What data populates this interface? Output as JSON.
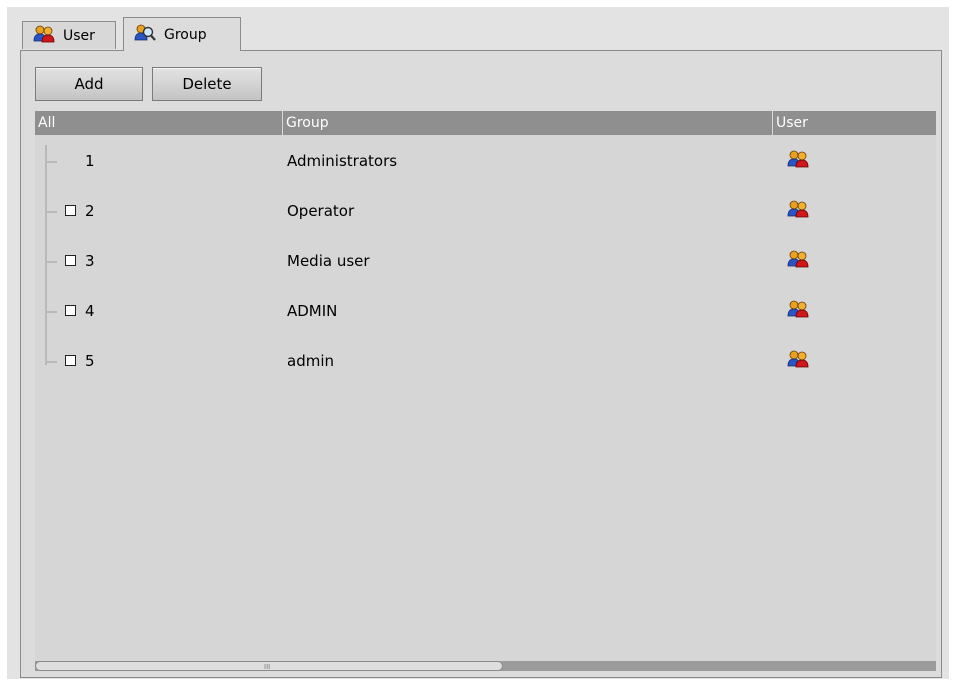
{
  "tabs": [
    {
      "label": "User",
      "icon": "users-icon",
      "active": false
    },
    {
      "label": "Group",
      "icon": "group-search-icon",
      "active": true
    }
  ],
  "toolbar": {
    "add_label": "Add",
    "delete_label": "Delete"
  },
  "table": {
    "headers": {
      "all": "All",
      "group": "Group",
      "user": "User"
    },
    "rows": [
      {
        "num": "1",
        "group": "Administrators",
        "checkbox": false
      },
      {
        "num": "2",
        "group": "Operator",
        "checkbox": true
      },
      {
        "num": "3",
        "group": "Media user",
        "checkbox": true
      },
      {
        "num": "4",
        "group": "ADMIN",
        "checkbox": true
      },
      {
        "num": "5",
        "group": "admin",
        "checkbox": true
      }
    ]
  },
  "scrollbar": {
    "grip": "III"
  },
  "colors": {
    "header_bg": "#8f8f8f",
    "grid_bg": "#d6d6d6",
    "icon_red": "#d01818",
    "icon_orange": "#e8a020"
  }
}
